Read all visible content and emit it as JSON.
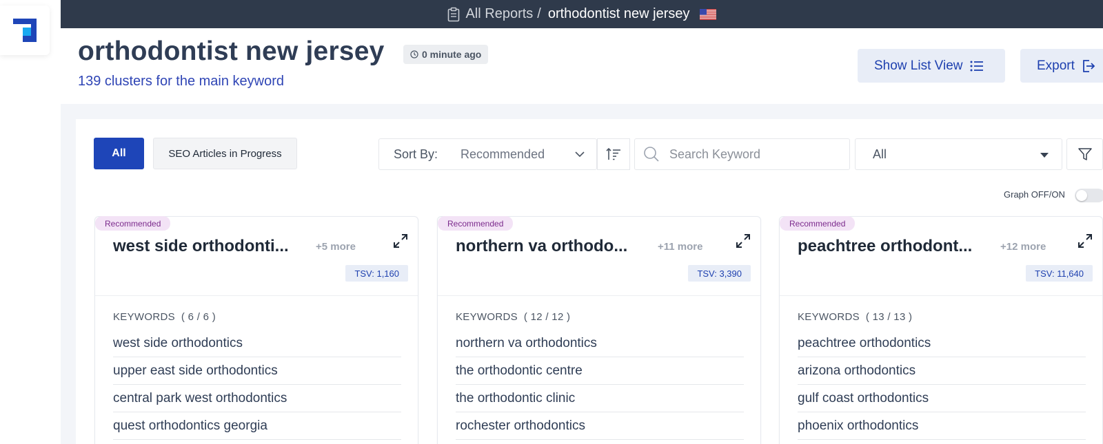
{
  "topbar": {
    "root_label": "All Reports",
    "separator": "/",
    "current_label": "orthodontist new jersey",
    "flag_icon": "us-flag-icon"
  },
  "header": {
    "title": "orthodontist new jersey",
    "time_badge": "0 minute ago",
    "subtitle": "139 clusters for the main keyword",
    "list_view_label": "Show List View",
    "export_label": "Export"
  },
  "toolbar": {
    "tab_all": "All",
    "tab_seo": "SEO Articles in Progress",
    "sort_label": "Sort By:",
    "sort_value": "Recommended",
    "search_placeholder": "Search Keyword",
    "filter_value": "All",
    "graph_toggle_label": "Graph OFF/ON",
    "graph_on": false
  },
  "colors": {
    "topbar": "#2f3a4b",
    "primary": "#1e45b8",
    "recommended_badge": "#f3e3f6",
    "tsv_badge": "#e8edf7"
  },
  "cards": [
    {
      "badge": "Recommended",
      "title": "west side orthodonti...",
      "more": "+5 more",
      "tsv": "TSV: 1,160",
      "keywords_label": "KEYWORDS",
      "keywords_count": "( 6 / 6 )",
      "keywords": [
        "west side orthodontics",
        "upper east side orthodontics",
        "central park west orthodontics",
        "quest orthodontics georgia"
      ]
    },
    {
      "badge": "Recommended",
      "title": "northern va orthodo...",
      "more": "+11 more",
      "tsv": "TSV: 3,390",
      "keywords_label": "KEYWORDS",
      "keywords_count": "( 12 / 12 )",
      "keywords": [
        "northern va orthodontics",
        "the orthodontic centre",
        "the orthodontic clinic",
        "rochester orthodontics"
      ]
    },
    {
      "badge": "Recommended",
      "title": "peachtree orthodont...",
      "more": "+12 more",
      "tsv": "TSV: 11,640",
      "keywords_label": "KEYWORDS",
      "keywords_count": "( 13 / 13 )",
      "keywords": [
        "peachtree orthodontics",
        "arizona orthodontics",
        "gulf coast orthodontics",
        "phoenix orthodontics"
      ]
    }
  ]
}
